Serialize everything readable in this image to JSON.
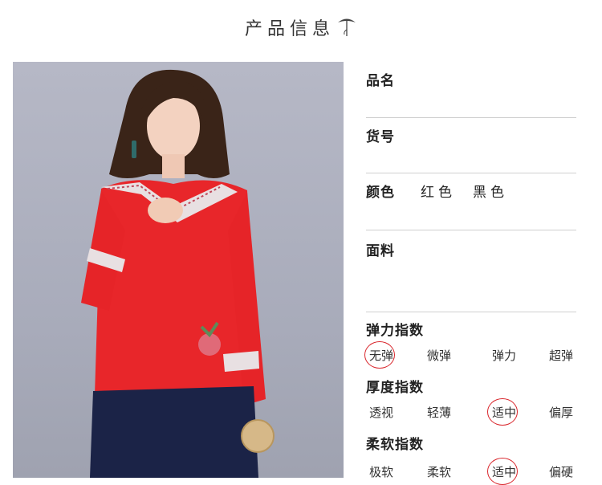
{
  "header": {
    "title": "产品信息",
    "icon": "lotus-leaf-icon"
  },
  "product": {
    "name_label": "品名",
    "sku_label": "货号",
    "color_label": "颜色",
    "colors": [
      "红色",
      "黑色"
    ],
    "fabric_label": "面料"
  },
  "indices": [
    {
      "label": "弹力指数",
      "options": [
        "无弹",
        "微弹",
        "弹力",
        "超弹"
      ],
      "selected": "无弹"
    },
    {
      "label": "厚度指数",
      "options": [
        "透视",
        "轻薄",
        "适中",
        "偏厚"
      ],
      "selected": "适中"
    },
    {
      "label": "柔软指数",
      "options": [
        "极软",
        "柔软",
        "适中",
        "偏硬"
      ],
      "selected": "适中"
    }
  ],
  "colors": {
    "selection_circle": "#d9262c",
    "shirt": "#e8262a",
    "skirt": "#1b2347",
    "background": "#adb0bf"
  }
}
